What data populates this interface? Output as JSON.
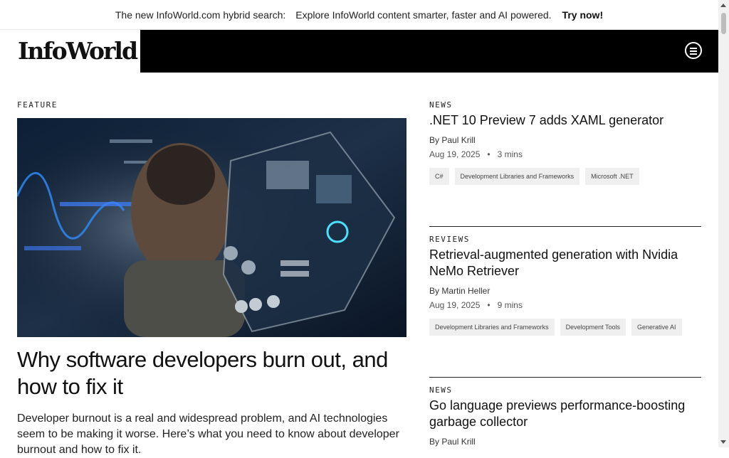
{
  "banner": {
    "lead": "The new InfoWorld.com hybrid search:",
    "explore": "Explore InfoWorld content smarter, faster and AI powered.",
    "cta": "Try now!"
  },
  "header": {
    "logo": "InfoWorld"
  },
  "feature": {
    "label": "FEATURE",
    "title": "Why software developers burn out, and how to fix it",
    "description": "Developer burnout is a real and widespread problem, and AI technologies seem to be making it worse. Here’s what you need to know about developer burnout and how to fix it."
  },
  "articles": [
    {
      "kicker": "NEWS",
      "title": ".NET 10 Preview 7 adds XAML generator",
      "byline": "By Paul Krill",
      "date": "Aug 19, 2025",
      "read": "3 mins",
      "tags": [
        "C#",
        "Development Libraries and Frameworks",
        "Microsoft .NET"
      ]
    },
    {
      "kicker": "REVIEWS",
      "title": "Retrieval-augmented generation with Nvidia NeMo Retriever",
      "byline": "By Martin Heller",
      "date": "Aug 19, 2025",
      "read": "9 mins",
      "tags": [
        "Development Libraries and Frameworks",
        "Development Tools",
        "Generative AI"
      ]
    },
    {
      "kicker": "NEWS",
      "title": "Go language previews performance-boosting garbage collector",
      "byline": "By Paul Krill"
    }
  ]
}
